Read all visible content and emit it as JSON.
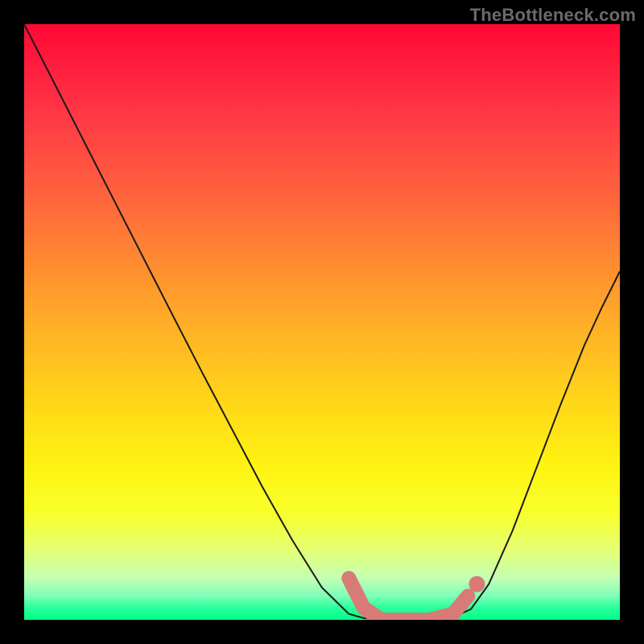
{
  "watermark": "TheBottleneck.com",
  "chart_data": {
    "type": "line",
    "title": "",
    "xlabel": "",
    "ylabel": "",
    "xlim": [
      0,
      1
    ],
    "ylim": [
      0,
      1
    ],
    "grid": false,
    "legend": false,
    "series": [
      {
        "name": "curve",
        "x": [
          0.0,
          0.05,
          0.1,
          0.15,
          0.2,
          0.25,
          0.3,
          0.35,
          0.4,
          0.45,
          0.5,
          0.545,
          0.57,
          0.6,
          0.64,
          0.68,
          0.72,
          0.75,
          0.78,
          0.82,
          0.86,
          0.9,
          0.94,
          0.97,
          1.0
        ],
        "y": [
          1.0,
          0.902,
          0.804,
          0.706,
          0.608,
          0.51,
          0.413,
          0.318,
          0.223,
          0.134,
          0.054,
          0.01,
          0.003,
          0.0,
          0.0,
          0.0,
          0.004,
          0.018,
          0.06,
          0.15,
          0.255,
          0.36,
          0.46,
          0.525,
          0.585
        ]
      }
    ],
    "highlight": {
      "name": "sweet-spot",
      "x": [
        0.545,
        0.57,
        0.6,
        0.64,
        0.68,
        0.72,
        0.745
      ],
      "y": [
        0.07,
        0.02,
        0.0,
        0.0,
        0.0,
        0.01,
        0.04
      ],
      "dot": {
        "x": 0.76,
        "y": 0.06
      }
    },
    "background": {
      "type": "vertical-gradient",
      "stops": [
        {
          "pos": 0.0,
          "color": "#ff0836"
        },
        {
          "pos": 0.5,
          "color": "#ffad28"
        },
        {
          "pos": 0.82,
          "color": "#f8ff2a"
        },
        {
          "pos": 1.0,
          "color": "#00ff86"
        }
      ]
    }
  }
}
